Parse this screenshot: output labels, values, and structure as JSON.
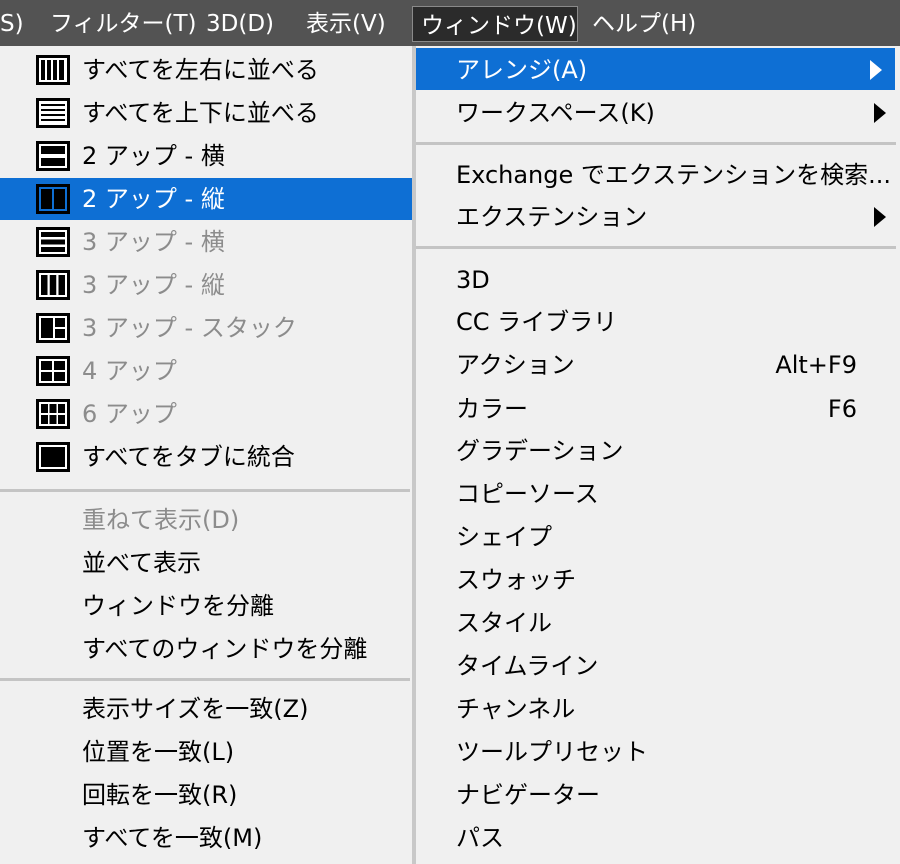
{
  "menubar": {
    "items": [
      "S)",
      "フィルター(T)",
      "3D(D)",
      "表示(V)",
      "ウィンドウ(W)",
      "ヘルプ(H)"
    ]
  },
  "arrange_submenu": {
    "layout_items": [
      {
        "label": "すべてを左右に並べる",
        "icon": "tile-all-vertical-icon",
        "state": "normal"
      },
      {
        "label": "すべてを上下に並べる",
        "icon": "tile-all-horizontal-icon",
        "state": "normal"
      },
      {
        "label": "2 アップ - 横",
        "icon": "two-up-horizontal-icon",
        "state": "normal"
      },
      {
        "label": "2 アップ - 縦",
        "icon": "two-up-vertical-icon",
        "state": "selected"
      },
      {
        "label": "3 アップ - 横",
        "icon": "three-up-horizontal-icon",
        "state": "disabled"
      },
      {
        "label": "3 アップ - 縦",
        "icon": "three-up-vertical-icon",
        "state": "disabled"
      },
      {
        "label": "3 アップ - スタック",
        "icon": "three-up-stacked-icon",
        "state": "disabled"
      },
      {
        "label": "4 アップ",
        "icon": "four-up-icon",
        "state": "disabled"
      },
      {
        "label": "6 アップ",
        "icon": "six-up-icon",
        "state": "disabled"
      },
      {
        "label": "すべてをタブに統合",
        "icon": "consolidate-tabs-icon",
        "state": "normal"
      }
    ],
    "window_items": [
      {
        "label": "重ねて表示(D)",
        "state": "disabled"
      },
      {
        "label": "並べて表示",
        "state": "normal"
      },
      {
        "label": "ウィンドウを分離",
        "state": "normal"
      },
      {
        "label": "すべてのウィンドウを分離",
        "state": "normal"
      }
    ],
    "match_items": [
      {
        "label": "表示サイズを一致(Z)",
        "state": "normal"
      },
      {
        "label": "位置を一致(L)",
        "state": "normal"
      },
      {
        "label": "回転を一致(R)",
        "state": "normal"
      },
      {
        "label": "すべてを一致(M)",
        "state": "normal"
      }
    ]
  },
  "window_menu": {
    "top_items": [
      {
        "label": "アレンジ(A)",
        "submenu": true,
        "state": "selected"
      },
      {
        "label": "ワークスペース(K)",
        "submenu": true,
        "state": "normal"
      }
    ],
    "extension_items": [
      {
        "label": "Exchange でエクステンションを検索...",
        "submenu": false
      },
      {
        "label": "エクステンション",
        "submenu": true
      }
    ],
    "panel_items": [
      {
        "label": "3D",
        "shortcut": ""
      },
      {
        "label": "CC ライブラリ",
        "shortcut": ""
      },
      {
        "label": "アクション",
        "shortcut": "Alt+F9"
      },
      {
        "label": "カラー",
        "shortcut": "F6"
      },
      {
        "label": "グラデーション",
        "shortcut": ""
      },
      {
        "label": "コピーソース",
        "shortcut": ""
      },
      {
        "label": "シェイプ",
        "shortcut": ""
      },
      {
        "label": "スウォッチ",
        "shortcut": ""
      },
      {
        "label": "スタイル",
        "shortcut": ""
      },
      {
        "label": "タイムライン",
        "shortcut": ""
      },
      {
        "label": "チャンネル",
        "shortcut": ""
      },
      {
        "label": "ツールプリセット",
        "shortcut": ""
      },
      {
        "label": "ナビゲーター",
        "shortcut": ""
      },
      {
        "label": "パス",
        "shortcut": ""
      }
    ]
  },
  "colors": {
    "menubar_bg": "#535353",
    "menu_bg": "#f0f0f0",
    "highlight": "#0e6fd4",
    "disabled_text": "#8c8c8c"
  }
}
